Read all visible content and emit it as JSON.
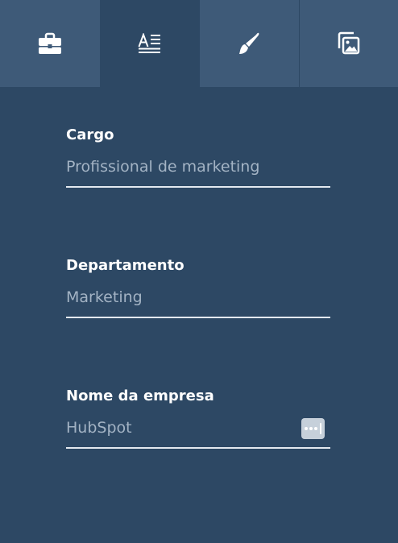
{
  "tabs": [
    {
      "id": "company",
      "icon": "briefcase-icon",
      "active": false
    },
    {
      "id": "text",
      "icon": "text-format-icon",
      "active": true
    },
    {
      "id": "style",
      "icon": "brush-icon",
      "active": false
    },
    {
      "id": "images",
      "icon": "image-copy-icon",
      "active": false
    }
  ],
  "fields": {
    "cargo": {
      "label": "Cargo",
      "value": "",
      "placeholder": "Profissional de marketing"
    },
    "departamento": {
      "label": "Departamento",
      "value": "",
      "placeholder": "Marketing"
    },
    "empresa": {
      "label": "Nome da empresa",
      "value": "",
      "placeholder": "HubSpot",
      "has_more_button": true
    }
  },
  "colors": {
    "background": "#2d4864",
    "tab_inactive": "#3e5a78",
    "icon": "#ffffff",
    "label": "#ffffff",
    "placeholder": "#a3b3c4",
    "underline": "#e3e9ef"
  }
}
